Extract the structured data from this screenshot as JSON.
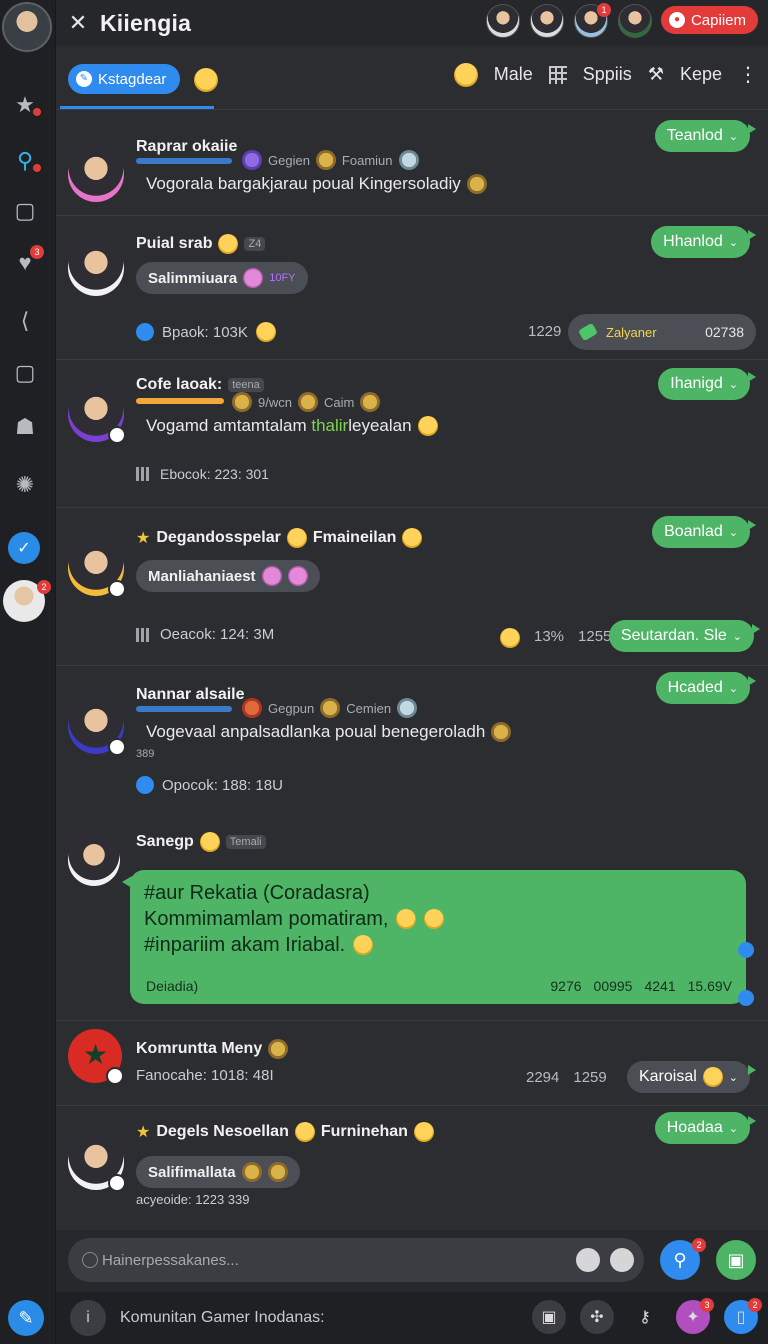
{
  "header": {
    "title": "Kiiengia",
    "close_icon": "close-icon",
    "cta_label": "Capiiem"
  },
  "tabs": {
    "active_label": "Kstagdear",
    "male_label": "Male",
    "spis_label": "Sppiis",
    "kepe_label": "Kepe"
  },
  "rows": [
    {
      "name": "Raprar okaiie",
      "chips": [
        "Gegien",
        "Foamiun"
      ],
      "message": "Vogorala bargakjarau poual Kingersoladiy",
      "pill": "Teanlod"
    },
    {
      "name": "Puial srab",
      "tag": "Z4",
      "bubble": "Salimmiuara",
      "bubble_small": "10FY",
      "stat": "Bpaok: 103K",
      "nums": [
        "1229",
        "02738"
      ],
      "chip_label": "Zalyaner",
      "pill": "Hhanlod"
    },
    {
      "name": "Cofe laoak:",
      "tag": "teena",
      "chips": [
        "9/wcn",
        "Caim"
      ],
      "message_pre": "Vogamd amtamtalam ",
      "message_mention": "thalir",
      "message_post": "leyealan",
      "stat": "Ebocok: 223: 301",
      "pill": "Ihanigd"
    },
    {
      "name": "Degandosspelar",
      "name2": "Fmaineilan",
      "bubble": "Manliahaniaest",
      "stat": "Oeacok: 124: 3M",
      "nums": [
        "13%",
        "1255"
      ],
      "pill": "Boanlad",
      "pill2": "Seutardan. Sle"
    },
    {
      "name": "Nannar alsaile",
      "chips": [
        "Gegpun",
        "Cemien"
      ],
      "message": "Vogevaal anpalsadlanka poual benegeroladh",
      "sub": "389",
      "stat": "Opocok: 188: 18U",
      "pill": "Hcaded"
    },
    {
      "name": "Sanegp",
      "tag": "Temali"
    },
    {
      "name": "Komruntta Meny",
      "stat": "Fanocahe: 1018: 48I",
      "nums": [
        "2294",
        "1259"
      ],
      "pill": "Karoisal"
    },
    {
      "name": "Degels Nesoellan",
      "name2": "Furninehan",
      "bubble": "Salifimallata",
      "stat": "acyeoide: 1223 339",
      "pill": "Hoadaa"
    }
  ],
  "big_bubble": {
    "line1": "#aur Rekatia (Coradasra)",
    "line2": "Kommimamlam pomatiram,",
    "line3": "#inpariim akam Iriabal.",
    "footer": "Deiadia)",
    "times": [
      "9276",
      "00995",
      "4241",
      "15.69V"
    ]
  },
  "composer": {
    "placeholder": "Hainerpessakanes..."
  },
  "bottom": {
    "label": "Komunitan Gamer Inodanas:"
  },
  "badges": {
    "rail_heart": "3",
    "rail_user": "2",
    "top_av": "1",
    "composer_a": "2",
    "bottom_a": "3",
    "bottom_b": "2"
  },
  "colors": {
    "accent_blue": "#2f8cee",
    "accent_green": "#4fb566",
    "cta_red": "#e33a3a"
  }
}
